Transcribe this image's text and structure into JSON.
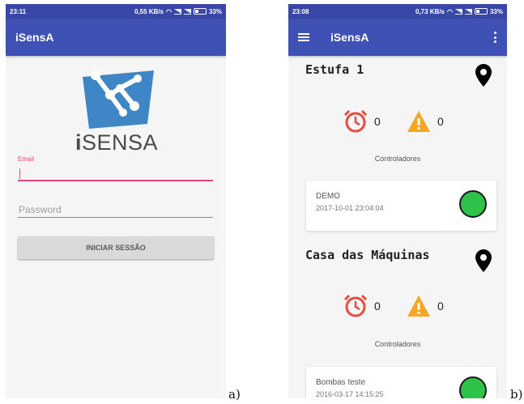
{
  "panel_a": {
    "label": "a)",
    "status": {
      "time": "23:11",
      "speed": "0,55 KB/s",
      "battery": "33%"
    },
    "toolbar": {
      "title": "iSensA"
    },
    "logo": {
      "text_bold": "i",
      "text_rest": "SENSA"
    },
    "form": {
      "email_label": "Email",
      "email_value": "",
      "password_placeholder": "Password",
      "login_button": "INICIAR SESSÃO"
    },
    "colors": {
      "primary": "#3f51b5",
      "accent": "#e8457a"
    }
  },
  "panel_b": {
    "label": "b)",
    "status": {
      "time": "23:08",
      "speed": "0,73 KB/s",
      "battery": "33%"
    },
    "toolbar": {
      "title": "iSensA"
    },
    "sections": [
      {
        "title": "Estufa 1",
        "alarms": "0",
        "warnings": "0",
        "controllers_label": "Controladores",
        "controller": {
          "name": "DEMO",
          "date": "2017-10-01 23:04:04",
          "status_color": "#2ec24a"
        }
      },
      {
        "title": "Casa das Máquinas",
        "alarms": "0",
        "warnings": "0",
        "controllers_label": "Controladores",
        "controller": {
          "name": "Bombas teste",
          "date": "2016-03-17 14:15:25",
          "status_color": "#2ec24a"
        }
      }
    ],
    "icons": {
      "alarm": "alarm-clock-icon",
      "warning": "warning-icon",
      "location": "location-pin-icon"
    },
    "colors": {
      "alarm": "#e94b3c",
      "warning": "#f5a623",
      "ok": "#2ec24a"
    }
  }
}
